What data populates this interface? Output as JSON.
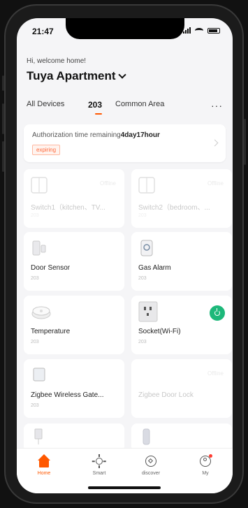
{
  "status": {
    "time": "21:47"
  },
  "header": {
    "welcome": "Hi, welcome home!",
    "home_name": "Tuya Apartment"
  },
  "tabs": {
    "all": "All Devices",
    "room": "203",
    "common": "Common Area",
    "more": "···"
  },
  "auth": {
    "text_prefix": "Authorization time remaining",
    "text_value": "4day17hour",
    "badge": "expiring"
  },
  "devices": [
    {
      "name": "Switch1（kitchen、TV...",
      "room": "203",
      "status": "Offline"
    },
    {
      "name": "Switch2（bedroom、...",
      "room": "203",
      "status": "Offline"
    },
    {
      "name": "Door Sensor",
      "room": "203",
      "status": ""
    },
    {
      "name": "Gas Alarm",
      "room": "203",
      "status": ""
    },
    {
      "name": "Temperature",
      "room": "203",
      "status": ""
    },
    {
      "name": "Socket(Wi-Fi)",
      "room": "203",
      "status": ""
    },
    {
      "name": "Zigbee Wireless Gate...",
      "room": "203",
      "status": ""
    },
    {
      "name": "Zigbee Door Lock",
      "room": "",
      "status": "Offline"
    }
  ],
  "tabbar": {
    "home": "Home",
    "smart": "Smart",
    "discover": "discover",
    "me": "My"
  },
  "colors": {
    "accent": "#ff5800",
    "power_on": "#1db87a",
    "background": "#f5f5f7"
  }
}
